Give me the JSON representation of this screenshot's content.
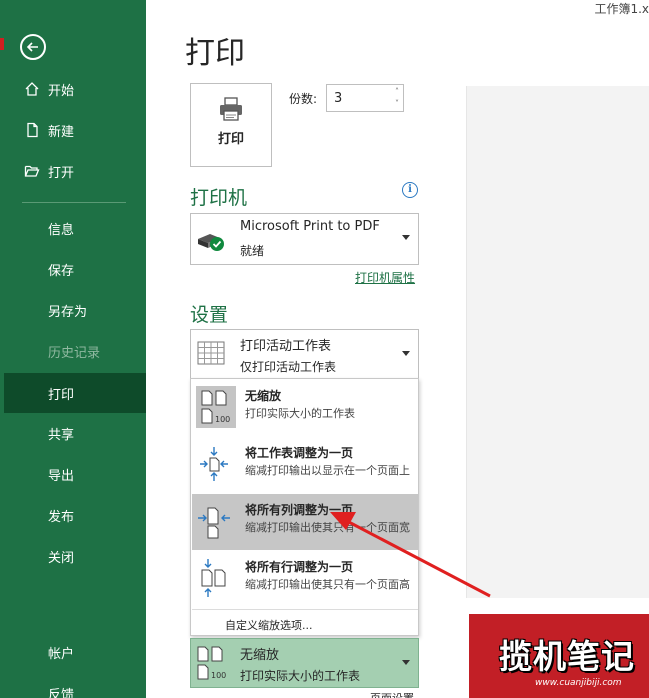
{
  "window": {
    "doc_title": "工作簿1.x"
  },
  "sidebar": {
    "items": [
      {
        "id": "home",
        "label": "开始",
        "icon": "home-icon"
      },
      {
        "id": "new",
        "label": "新建",
        "icon": "new-document-icon"
      },
      {
        "id": "open",
        "label": "打开",
        "icon": "folder-open-icon"
      },
      {
        "id": "info",
        "label": "信息"
      },
      {
        "id": "save",
        "label": "保存"
      },
      {
        "id": "saveas",
        "label": "另存为"
      },
      {
        "id": "history",
        "label": "历史记录",
        "disabled": true
      },
      {
        "id": "print",
        "label": "打印",
        "active": true
      },
      {
        "id": "share",
        "label": "共享"
      },
      {
        "id": "export",
        "label": "导出"
      },
      {
        "id": "publish",
        "label": "发布"
      },
      {
        "id": "close",
        "label": "关闭"
      },
      {
        "id": "account",
        "label": "帐户"
      },
      {
        "id": "feedback",
        "label": "反馈"
      }
    ]
  },
  "main": {
    "title": "打印",
    "print_button": {
      "label": "打印"
    },
    "copies": {
      "label": "份数:",
      "value": "3"
    },
    "printer": {
      "section_title": "打印机",
      "name": "Microsoft Print to PDF",
      "status": "就绪",
      "properties_link": "打印机属性"
    },
    "settings": {
      "section_title": "设置",
      "scope": {
        "title": "打印活动工作表",
        "desc": "仅打印活动工作表"
      },
      "scaling_menu": [
        {
          "title": "无缩放",
          "desc": "打印实际大小的工作表"
        },
        {
          "title": "将工作表调整为一页",
          "desc": "缩减打印输出以显示在一个页面上"
        },
        {
          "title": "将所有列调整为一页",
          "desc": "缩减打印输出使其只有一个页面宽",
          "highlighted": true
        },
        {
          "title": "将所有行调整为一页",
          "desc": "缩减打印输出使其只有一个页面高"
        }
      ],
      "custom_scaling": "自定义缩放选项...",
      "current_scaling": {
        "title": "无缩放",
        "desc": "打印实际大小的工作表"
      },
      "page_setup_link": "页面设置"
    }
  },
  "watermark": {
    "text": "揽机笔记",
    "url": "www.cuanjibiji.com"
  },
  "colors": {
    "sidebar": "#1e7145",
    "sidebar_active": "#0e4b2a",
    "accent": "#1e7145",
    "arrow": "#e02020",
    "highlight": "#c6c6c6",
    "selected_scaling": "#a4cfb1"
  }
}
